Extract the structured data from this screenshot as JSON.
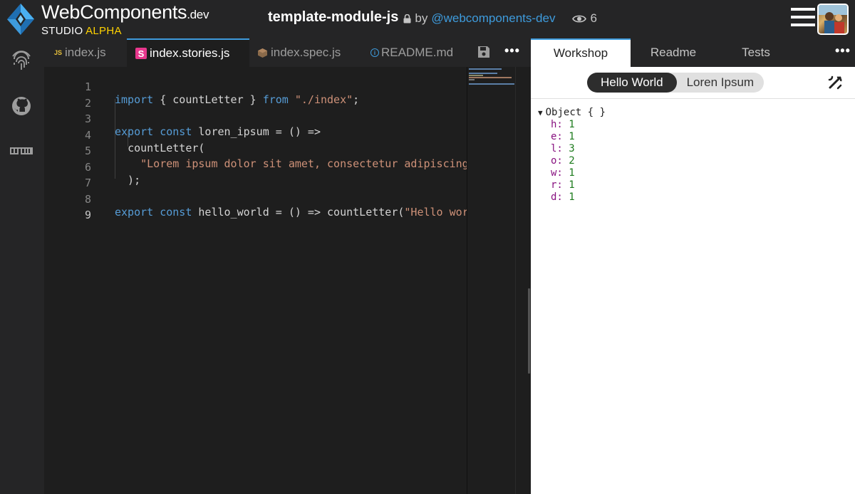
{
  "header": {
    "brand_name": "WebComponents",
    "brand_suffix": ".dev",
    "studio_label": "STUDIO",
    "alpha_label": "ALPHA",
    "project_name": "template-module-js",
    "by_label": "by",
    "owner": "@webcomponents-dev",
    "view_count": "6"
  },
  "editor_tabs": [
    {
      "label": "index.js",
      "badge": "JS"
    },
    {
      "label": "index.stories.js",
      "badge": "S"
    },
    {
      "label": "index.spec.js"
    },
    {
      "label": "README.md",
      "badge": "i"
    }
  ],
  "editor_more": "•••",
  "code": {
    "line_numbers": [
      "1",
      "2",
      "3",
      "4",
      "5",
      "6",
      "7",
      "8",
      "9"
    ],
    "l1": {
      "kw1": "import",
      "mid": " { countLetter } ",
      "kw2": "from",
      "sp": " ",
      "str": "\"./index\"",
      "end": ";"
    },
    "l3": {
      "kw1": "export",
      "sp": " ",
      "kw2": "const",
      "rest": " loren_ipsum = () =>"
    },
    "l4": {
      "indent": "  ",
      "fn": "countLetter("
    },
    "l5": {
      "indent": "    ",
      "str": "\"Lorem ipsum dolor sit amet, consectetur adipiscing"
    },
    "l6": {
      "text": "  );"
    },
    "l8": {
      "kw1": "export",
      "sp": " ",
      "kw2": "const",
      "rest": " hello_world = () => countLetter(",
      "str": "\"Hello wor"
    }
  },
  "right_tabs": [
    {
      "label": "Workshop"
    },
    {
      "label": "Readme"
    },
    {
      "label": "Tests"
    }
  ],
  "right_more": "•••",
  "story_toggle": {
    "options": [
      "Hello World",
      "Loren Ipsum"
    ],
    "selected": "Hello World"
  },
  "output": {
    "header": "Object { }",
    "entries": [
      {
        "key": "h:",
        "value": "1"
      },
      {
        "key": "e:",
        "value": "1"
      },
      {
        "key": "l:",
        "value": "3"
      },
      {
        "key": "o:",
        "value": "2"
      },
      {
        "key": "w:",
        "value": "1"
      },
      {
        "key": "r:",
        "value": "1"
      },
      {
        "key": "d:",
        "value": "1"
      }
    ]
  },
  "icons": {
    "activity": [
      "fingerprint-icon",
      "github-icon",
      "npm-icon"
    ],
    "accent": "#3e9bdc",
    "alpha_color": "#ffd200"
  }
}
